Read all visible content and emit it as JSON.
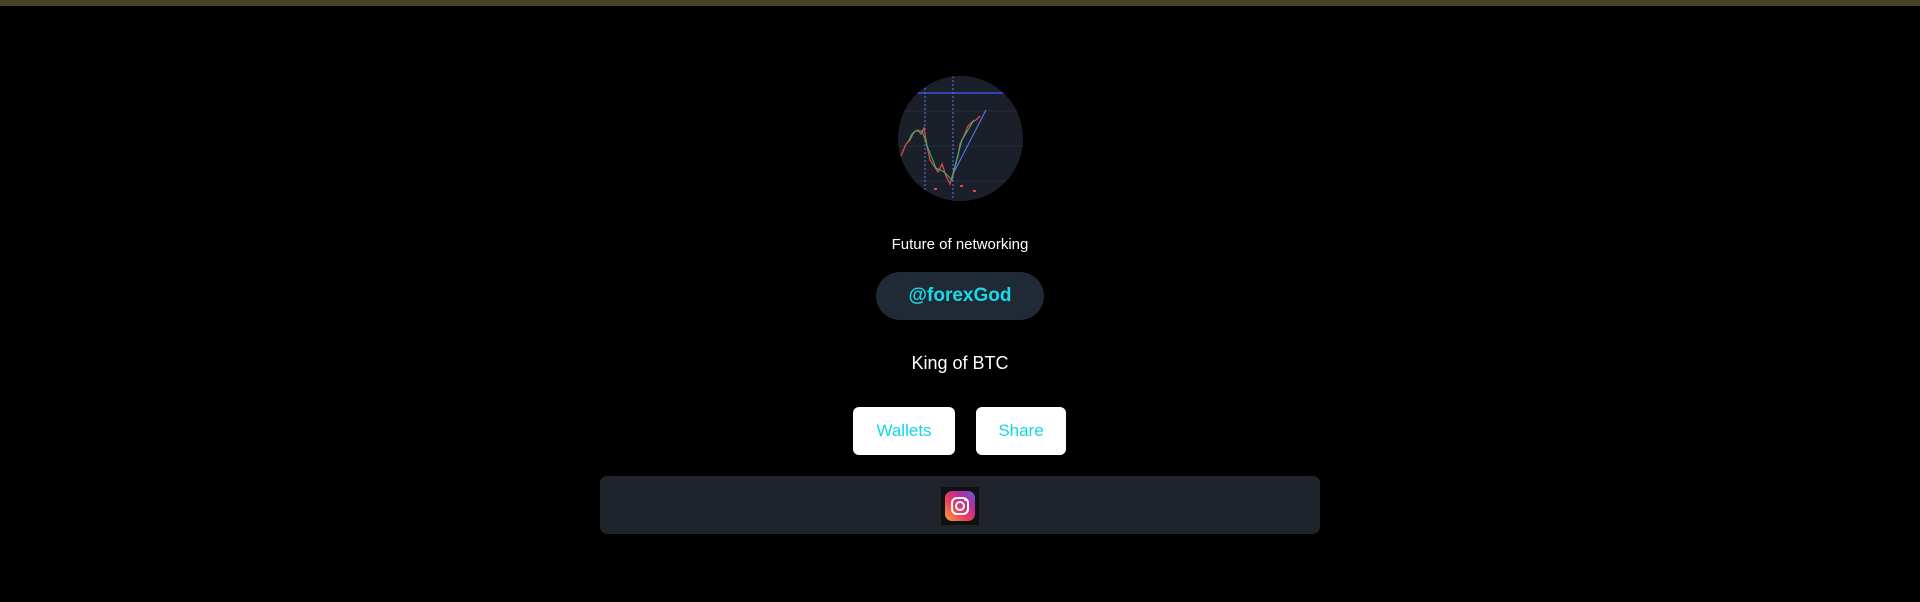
{
  "profile": {
    "tagline": "Future of networking",
    "handle": "@forexGod",
    "bio": "King of BTC"
  },
  "actions": {
    "wallets_label": "Wallets",
    "share_label": "Share"
  },
  "socials": {
    "items": [
      {
        "icon": "instagram-icon"
      }
    ]
  },
  "colors": {
    "background": "#000000",
    "accent": "#13d6e6",
    "pill_background": "#1f2a36",
    "social_bar_background": "#1f232c",
    "button_background": "#ffffff"
  }
}
